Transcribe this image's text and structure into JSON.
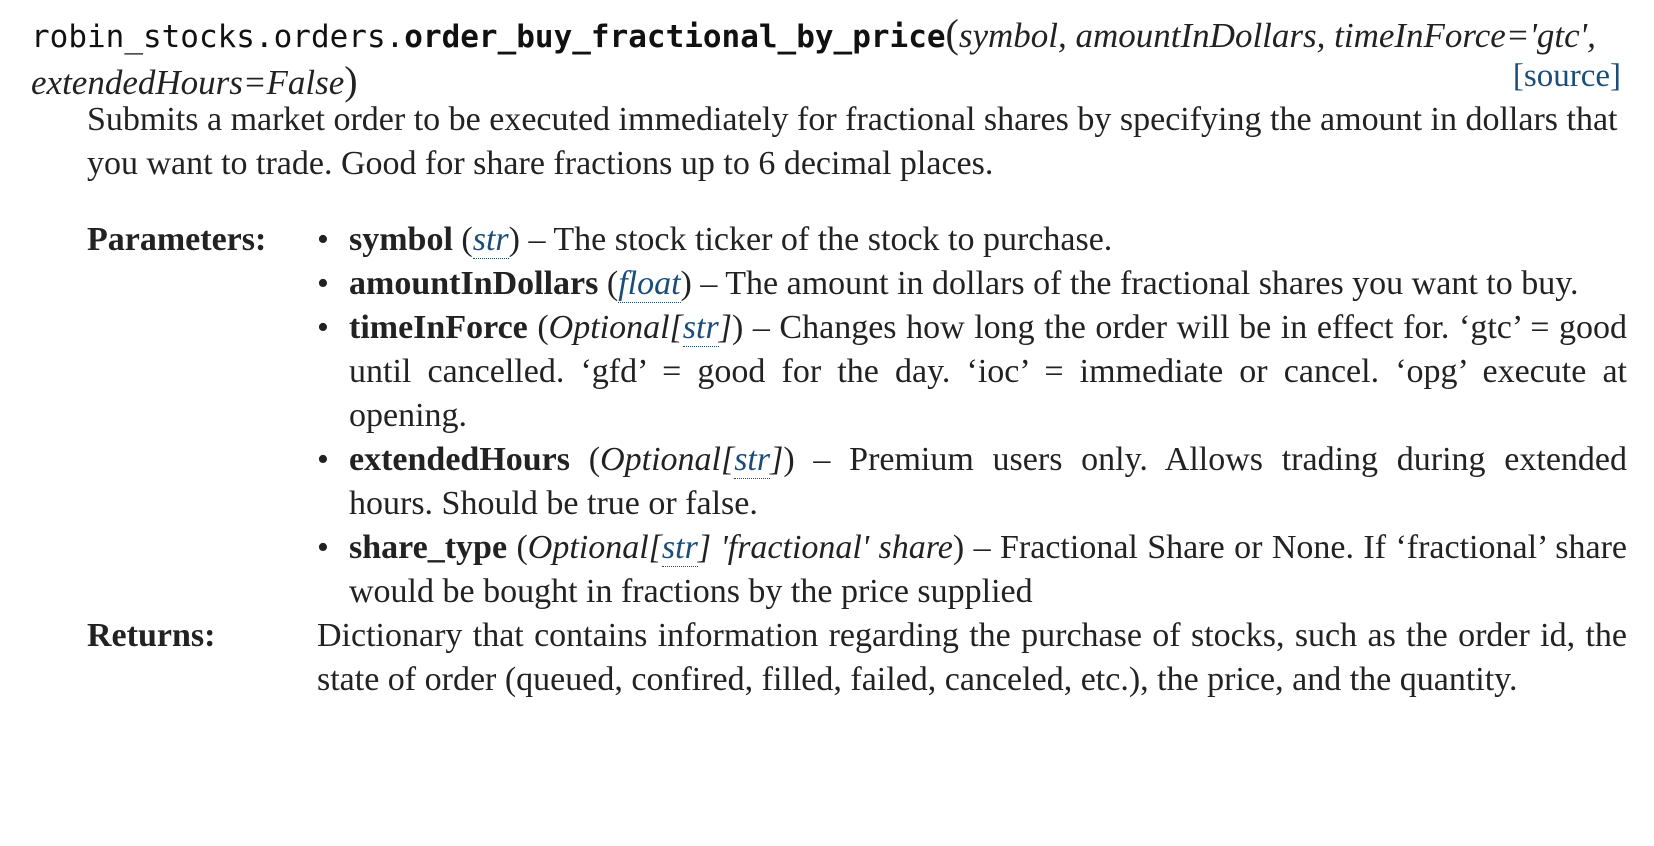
{
  "signature": {
    "module": "robin_stocks.orders.",
    "name": "order_buy_fractional_by_price",
    "open_paren": "(",
    "close_paren": ")",
    "params_text": "symbol, amountInDollars, timeInForce='gtc', extendedHours=False",
    "source_link": "[source]"
  },
  "description": "Submits a market order to be executed immediately for fractional shares by specifying the amount in dollars that you want to trade. Good for share fractions up to 6 decimal places.",
  "parameters_label": "Parameters:",
  "parameters": [
    {
      "name": "symbol",
      "type_open": "(",
      "type_prefix": "",
      "type_link": "str",
      "type_suffix": "",
      "type_close": ")",
      "desc": " – The stock ticker of the stock to purchase."
    },
    {
      "name": "amountInDollars",
      "type_open": "(",
      "type_prefix": "",
      "type_link": "float",
      "type_suffix": "",
      "type_close": ")",
      "desc": " – The amount in dollars of the fractional shares you want to buy."
    },
    {
      "name": "timeInForce",
      "type_open": "(",
      "type_prefix": "Optional[",
      "type_link": "str",
      "type_suffix": "]",
      "type_close": ")",
      "desc": " – Changes how long the order will be in effect for. ‘gtc’ = good until cancelled. ‘gfd’ = good for the day. ‘ioc’ = immediate or cancel. ‘opg’ execute at opening."
    },
    {
      "name": "extendedHours",
      "type_open": "(",
      "type_prefix": "Optional[",
      "type_link": "str",
      "type_suffix": "]",
      "type_close": ")",
      "desc": " – Premium users only. Allows trading during extended hours. Should be true or false."
    },
    {
      "name": "share_type",
      "type_open": "(",
      "type_prefix": "Optional[",
      "type_link": "str",
      "type_suffix": "] 'fractional' share",
      "type_close": ")",
      "desc": " – Fractional Share or None. If ‘fractional’ share would be bought in fractions by the price supplied"
    }
  ],
  "returns_label": "Returns:",
  "returns": "Dictionary that contains information regarding the purchase of stocks, such as the order id, the state of order (queued, confired, filled, failed, canceled, etc.), the price, and the quantity.",
  "colors": {
    "link": "#1a4d7a",
    "text": "#222222"
  }
}
